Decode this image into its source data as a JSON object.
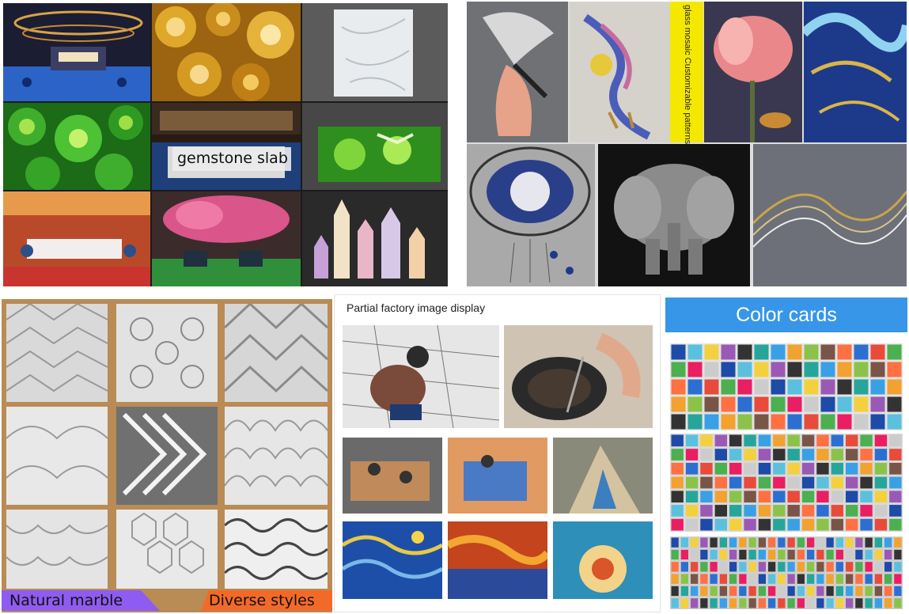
{
  "gemstone": {
    "label": "gemstone slab"
  },
  "art": {
    "strip_text": "glass mosaic Customizable patterns and sizes"
  },
  "marble": {
    "badge_left": "Natural marble",
    "badge_right": "Diverse styles"
  },
  "factory": {
    "title": "Partial factory image display"
  },
  "cards": {
    "title": "Color cards"
  },
  "colors": {
    "agate_gold": "#c98d1e",
    "agate_green": "#3fae2c",
    "mosaic_blue": "#1d4fa8",
    "marble_white": "#efefef",
    "wood": "#b98b55",
    "header_blue": "#3796e8",
    "badge_purple": "#8e5cf0",
    "badge_orange": "#f36a28"
  }
}
